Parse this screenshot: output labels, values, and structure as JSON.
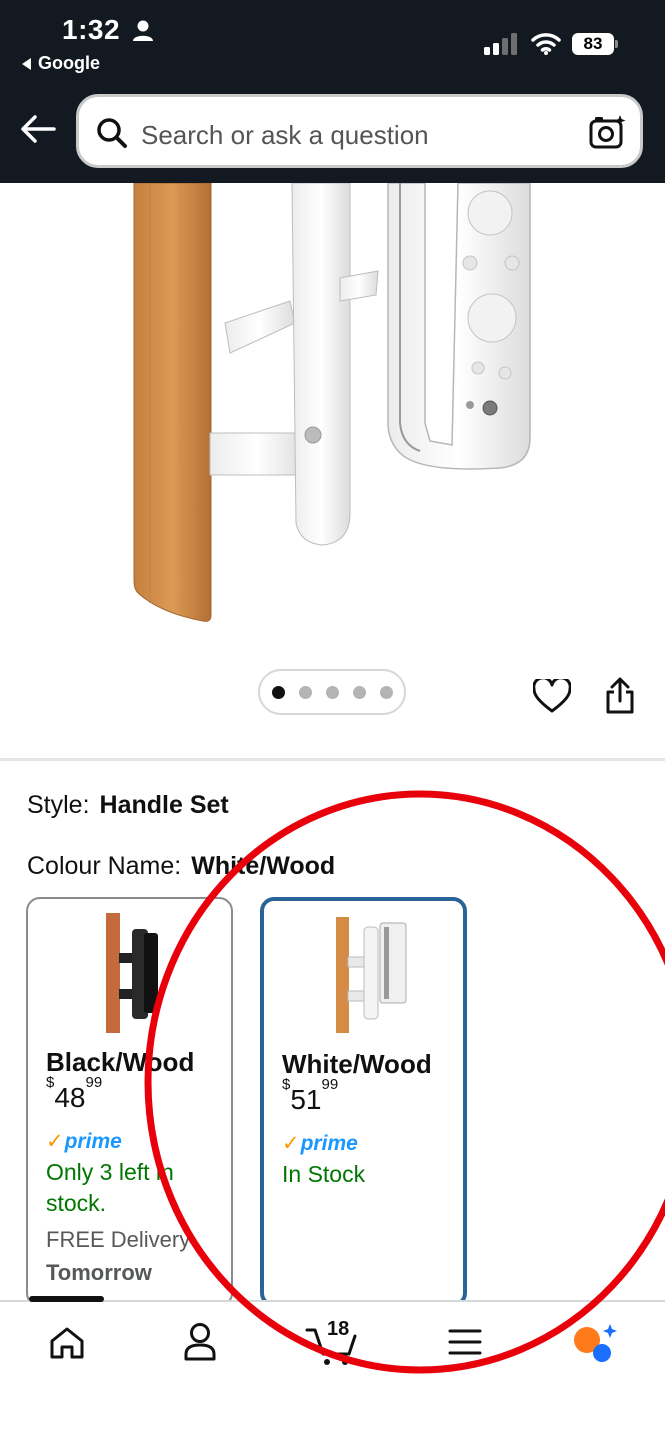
{
  "status_bar": {
    "time": "1:32",
    "back_app": "Google",
    "battery": "83"
  },
  "search": {
    "placeholder": "Search or ask a question"
  },
  "gallery": {
    "image_count": 5,
    "active_index": 0
  },
  "variations": {
    "style_label": "Style:",
    "style_value": "Handle Set",
    "colour_label": "Colour Name:",
    "colour_value": "White/Wood",
    "options": [
      {
        "name": "Black/Wood",
        "price_currency": "$",
        "price_whole": "48",
        "price_fraction": "99",
        "prime": "prime",
        "stock": "Only 3 left in stock.",
        "delivery_prefix": "FREE Delivery",
        "delivery_day": "Tomorrow",
        "selected": false
      },
      {
        "name": "White/Wood",
        "price_currency": "$",
        "price_whole": "51",
        "price_fraction": "99",
        "prime": "prime",
        "stock": "In Stock",
        "selected": true
      }
    ]
  },
  "bottom_nav": {
    "cart_count": "18",
    "items": [
      "home-icon",
      "account-icon",
      "cart-icon",
      "menu-icon",
      "rufus-icon"
    ]
  },
  "colors": {
    "header_bg": "#131921",
    "selected_border": "#2a6496",
    "stock_green": "#007600",
    "prime_blue": "#1a98ff",
    "annotation_red": "#e8000b"
  }
}
